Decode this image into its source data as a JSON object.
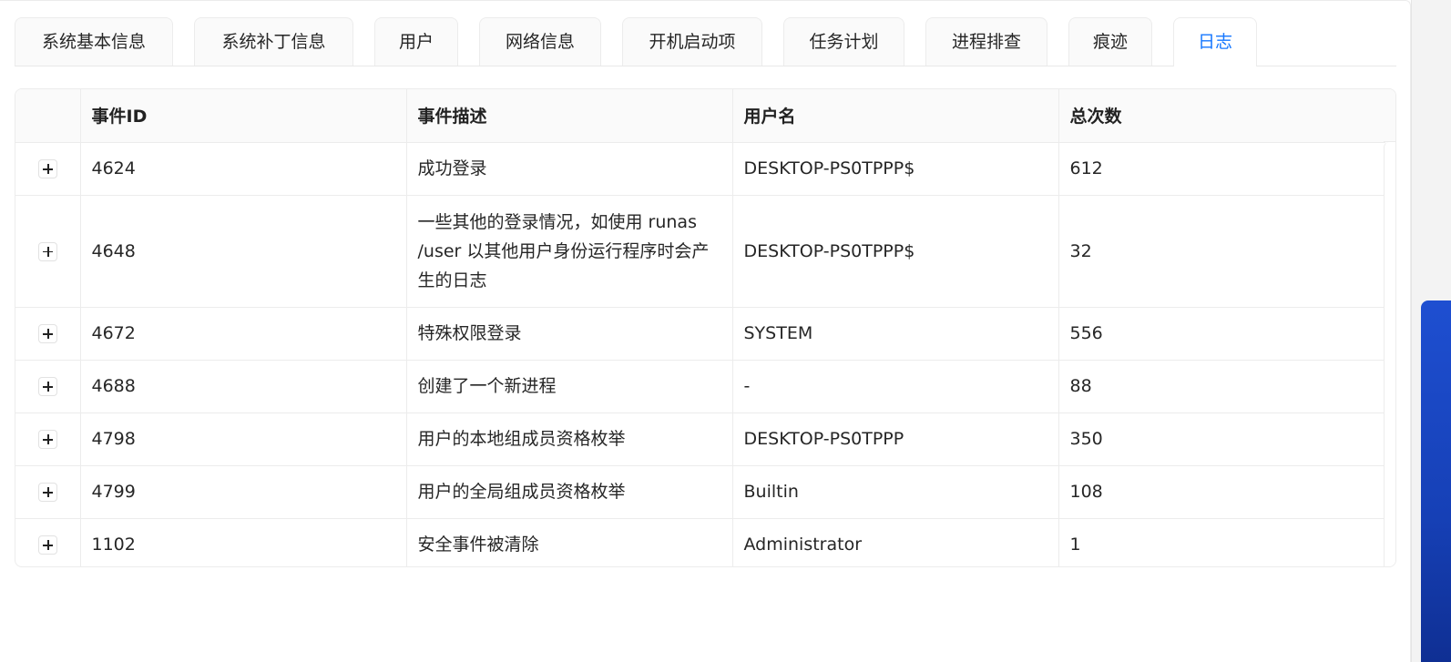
{
  "tabs": [
    {
      "label": "系统基本信息"
    },
    {
      "label": "系统补丁信息"
    },
    {
      "label": "用户"
    },
    {
      "label": "网络信息"
    },
    {
      "label": "开机启动项"
    },
    {
      "label": "任务计划"
    },
    {
      "label": "进程排查"
    },
    {
      "label": "痕迹"
    },
    {
      "label": "日志"
    }
  ],
  "active_tab": "日志",
  "accent_color": "#1677ff",
  "table": {
    "columns": [
      "",
      "事件ID",
      "事件描述",
      "用户名",
      "总次数"
    ],
    "rows": [
      {
        "event_id": "4624",
        "description": "成功登录",
        "user": "DESKTOP-PS0TPPP$",
        "count": "612"
      },
      {
        "event_id": "4648",
        "description": "一些其他的登录情况，如使用 runas /user 以其他用户身份运行程序时会产生的日志",
        "user": "DESKTOP-PS0TPPP$",
        "count": "32"
      },
      {
        "event_id": "4672",
        "description": "特殊权限登录",
        "user": "SYSTEM",
        "count": "556"
      },
      {
        "event_id": "4688",
        "description": "创建了一个新进程",
        "user": "-",
        "count": "88"
      },
      {
        "event_id": "4798",
        "description": "用户的本地组成员资格枚举",
        "user": "DESKTOP-PS0TPPP",
        "count": "350"
      },
      {
        "event_id": "4799",
        "description": "用户的全局组成员资格枚举",
        "user": "Builtin",
        "count": "108"
      },
      {
        "event_id": "1102",
        "description": "安全事件被清除",
        "user": "Administrator",
        "count": "1"
      }
    ],
    "expand_icon": "plus-icon"
  }
}
